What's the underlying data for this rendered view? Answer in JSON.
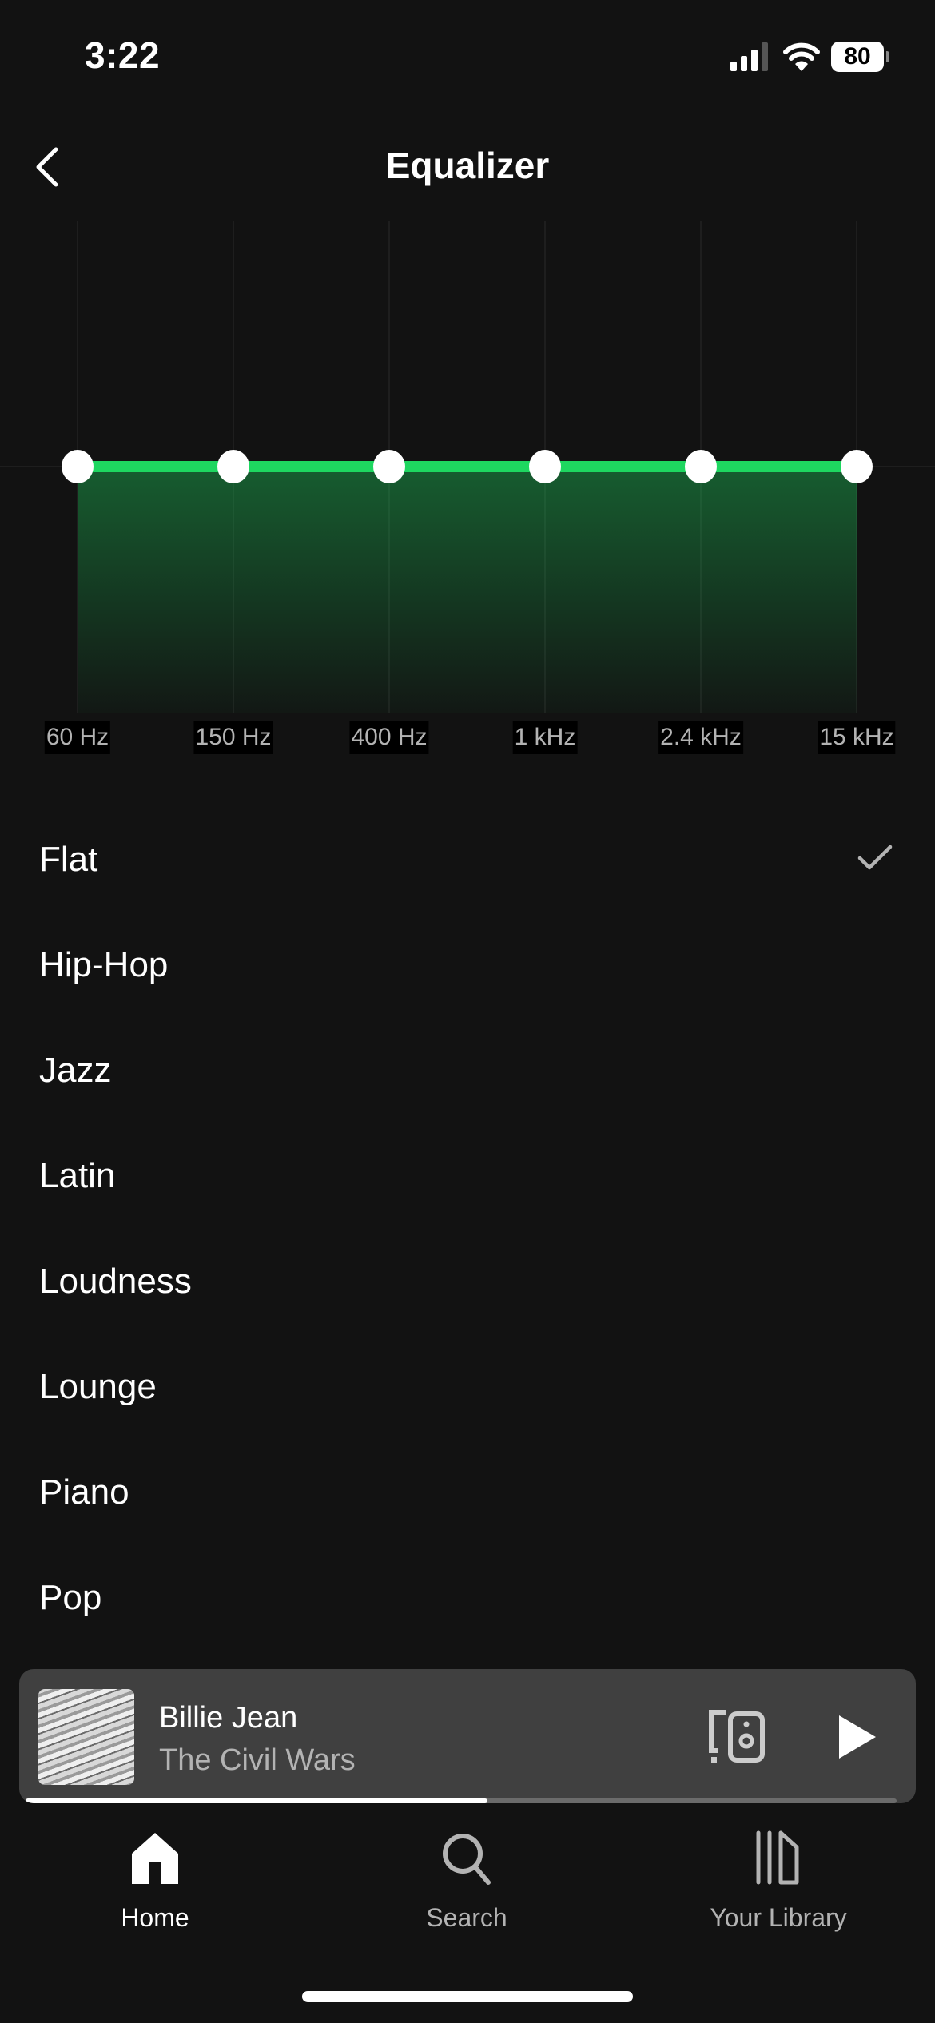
{
  "status_bar": {
    "time": "3:22",
    "battery": "80",
    "signal_bars_active": 3,
    "signal_bars_total": 4
  },
  "header": {
    "title": "Equalizer",
    "back_icon": "chevron-left-icon"
  },
  "chart_data": {
    "type": "line",
    "title": "",
    "xlabel": "",
    "ylabel": "",
    "categories": [
      "60 Hz",
      "150 Hz",
      "400 Hz",
      "1 kHz",
      "2.4 kHz",
      "15 kHz"
    ],
    "series": [
      {
        "name": "Flat",
        "values": [
          0,
          0,
          0,
          0,
          0,
          0
        ]
      }
    ],
    "ylim": [
      -12,
      12
    ],
    "grid": true,
    "line_color": "#1ed760",
    "fill": "area-gradient",
    "legend": "none"
  },
  "presets": {
    "selected": "Flat",
    "items": [
      {
        "label": "Flat",
        "selected": true
      },
      {
        "label": "Hip-Hop",
        "selected": false
      },
      {
        "label": "Jazz",
        "selected": false
      },
      {
        "label": "Latin",
        "selected": false
      },
      {
        "label": "Loudness",
        "selected": false
      },
      {
        "label": "Lounge",
        "selected": false
      },
      {
        "label": "Piano",
        "selected": false
      },
      {
        "label": "Pop",
        "selected": false
      }
    ]
  },
  "mini_player": {
    "title": "Billie Jean",
    "artist": "The Civil Wars",
    "progress": 0.53,
    "device_icon": "connect-device-icon",
    "play_icon": "play-icon"
  },
  "nav": {
    "items": [
      {
        "label": "Home",
        "icon": "home-icon",
        "active": true
      },
      {
        "label": "Search",
        "icon": "search-icon",
        "active": false
      },
      {
        "label": "Your Library",
        "icon": "library-icon",
        "active": false
      }
    ]
  },
  "colors": {
    "accent": "#1ed760",
    "background": "#121212",
    "player_bg": "#404040",
    "muted_text": "#b3b3b3"
  }
}
